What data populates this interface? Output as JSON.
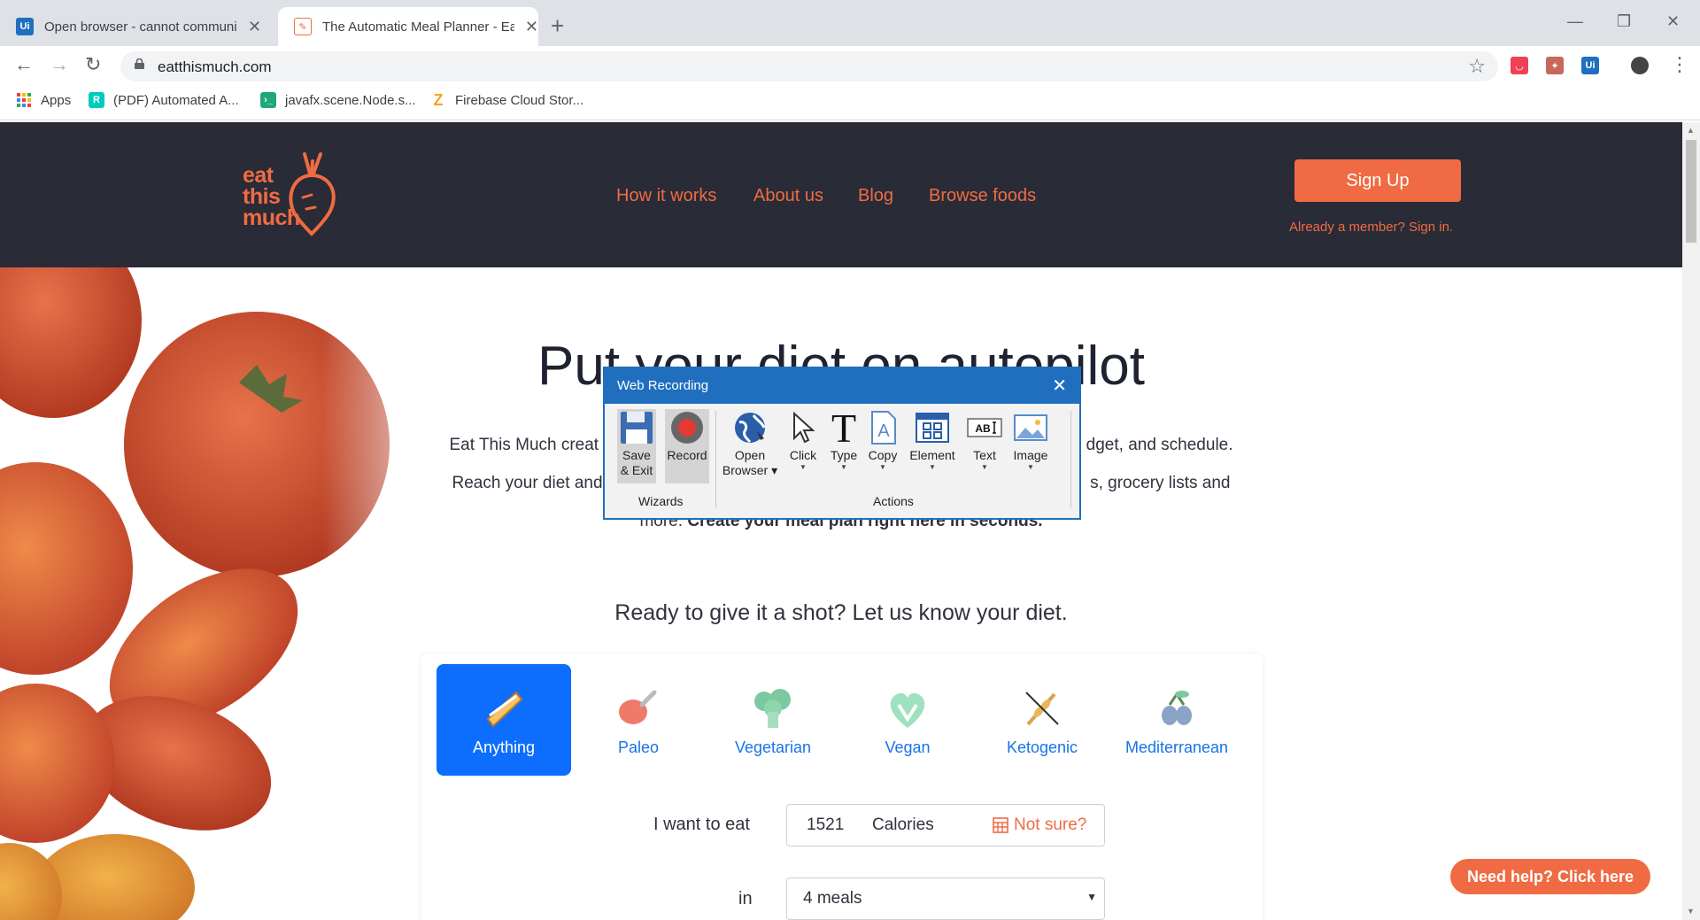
{
  "browser": {
    "tabs": [
      {
        "title": "Open browser - cannot communi",
        "active": false,
        "favicon": "uipath-icon"
      },
      {
        "title": "The Automatic Meal Planner - Ea",
        "active": true,
        "favicon": "eatthismuch-icon"
      }
    ],
    "url": "eatthismuch.com",
    "bookmarks": [
      {
        "label": "Apps",
        "icon": "apps-grid-icon"
      },
      {
        "label": "(PDF) Automated A...",
        "icon": "researchgate-icon"
      },
      {
        "label": "javafx.scene.Node.s...",
        "icon": "terminal-icon"
      },
      {
        "label": "Firebase Cloud Stor...",
        "icon": "zotero-icon"
      }
    ]
  },
  "site": {
    "logo_text": [
      "eat",
      "this",
      "much"
    ],
    "nav": [
      "How it works",
      "About us",
      "Blog",
      "Browse foods"
    ],
    "signup_label": "Sign Up",
    "member_link": "Already a member? Sign in.",
    "headline": "Put your diet on autopilot",
    "lead1_left": "Eat This Much creat",
    "lead1_right": "dget, and schedule.",
    "lead2_left": "Reach your diet and",
    "lead2_right": "s, grocery lists and",
    "lead3_plain": "more. ",
    "lead3_bold": "Create your meal plan right here in seconds.",
    "ready": "Ready to give it a shot? Let us know your diet.",
    "diets": [
      {
        "label": "Anything",
        "selected": true
      },
      {
        "label": "Paleo",
        "selected": false
      },
      {
        "label": "Vegetarian",
        "selected": false
      },
      {
        "label": "Vegan",
        "selected": false
      },
      {
        "label": "Ketogenic",
        "selected": false
      },
      {
        "label": "Mediterranean",
        "selected": false
      }
    ],
    "want_label": "I want to eat",
    "calories_value": "1521",
    "calories_unit": "Calories",
    "not_sure": "Not sure?",
    "in_label": "in",
    "meals_value": "4 meals",
    "help_button": "Need help? Click here"
  },
  "dialog": {
    "title": "Web Recording",
    "wizards_group": "Wizards",
    "actions_group": "Actions",
    "save_exit": [
      "Save",
      "& Exit"
    ],
    "record": "Record",
    "open_browser": [
      "Open",
      "Browser"
    ],
    "click": "Click",
    "type": "Type",
    "copy": "Copy",
    "element": "Element",
    "text": "Text",
    "image": "Image"
  },
  "colors": {
    "brand": "#f06b43",
    "header_bg": "#292b36",
    "selected_diet": "#0d6efd",
    "dialog_blue": "#1f6fbe"
  }
}
